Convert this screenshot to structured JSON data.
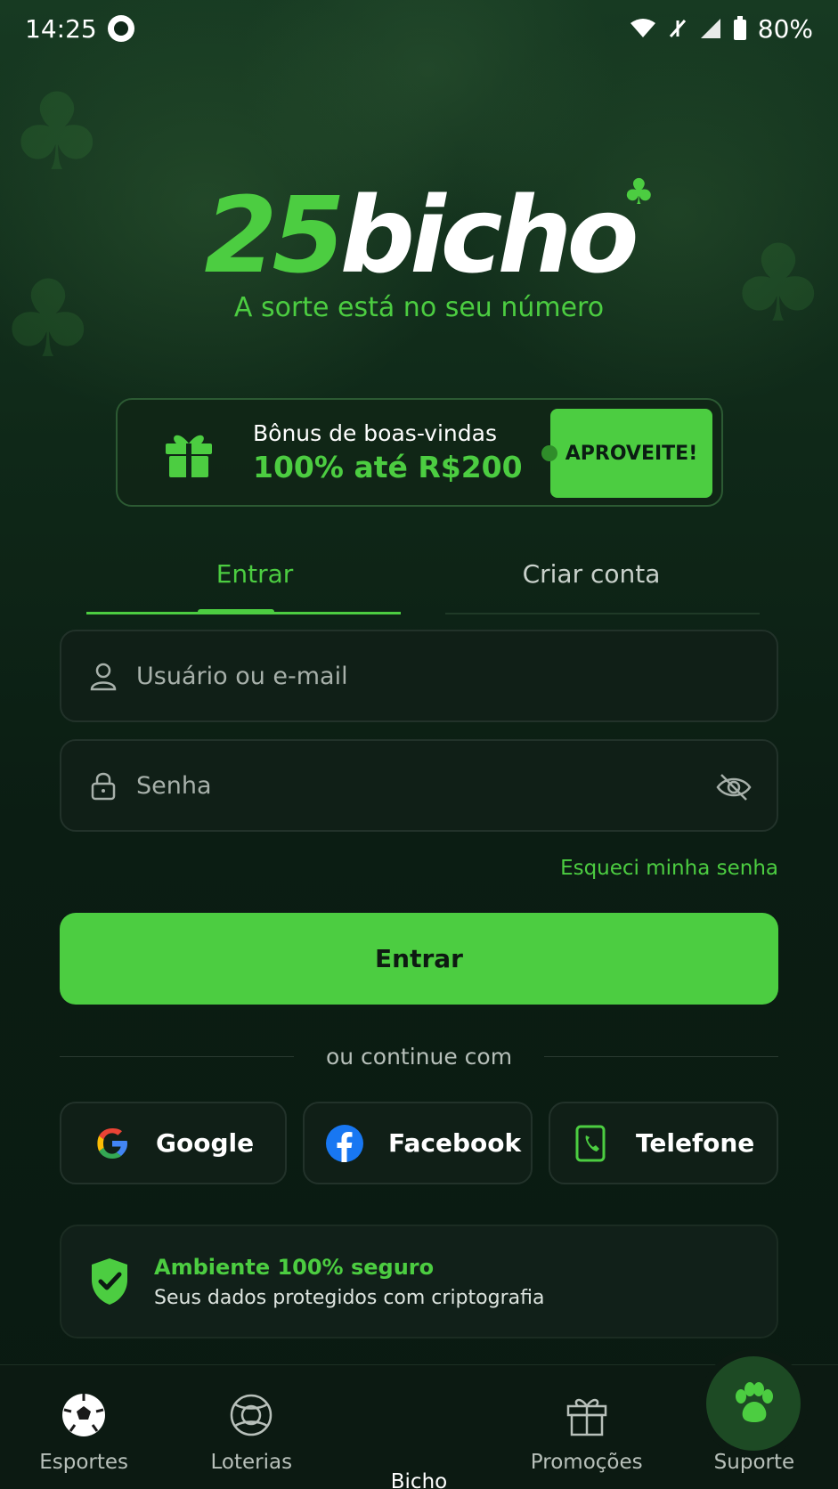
{
  "status_bar": {
    "time": "14:25",
    "battery": "80%"
  },
  "brand": {
    "number": "25",
    "name": "bicho",
    "tagline": "A sorte está no seu número"
  },
  "bonus": {
    "title": "Bônus de boas-vindas",
    "offer": "100% até R$200",
    "cta": "APROVEITE!"
  },
  "tabs": {
    "login": "Entrar",
    "signup": "Criar conta"
  },
  "form": {
    "user_placeholder": "Usuário ou e-mail",
    "password_placeholder": "Senha",
    "forgot": "Esqueci minha senha",
    "submit": "Entrar"
  },
  "divider": "ou continue com",
  "socials": {
    "google": "Google",
    "facebook": "Facebook",
    "phone": "Telefone"
  },
  "secure": {
    "title": "Ambiente 100% seguro",
    "subtitle": "Seus dados protegidos com criptografia"
  },
  "nav": {
    "items": [
      {
        "label": "Esportes"
      },
      {
        "label": "Loterias"
      },
      {
        "label": "Bicho"
      },
      {
        "label": "Promoções"
      },
      {
        "label": "Suporte"
      }
    ]
  },
  "colors": {
    "accent": "#4ccd41",
    "background": "#0b1c12",
    "surface": "#101f17"
  }
}
